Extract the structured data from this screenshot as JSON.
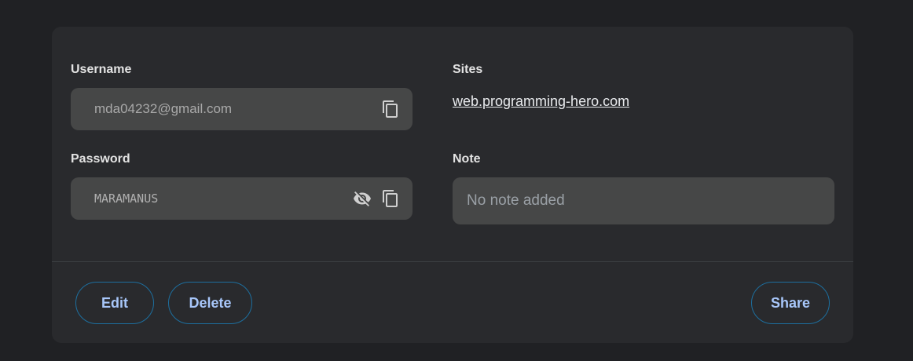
{
  "fields": {
    "username_label": "Username",
    "username_value": "mda04232@gmail.com",
    "password_label": "Password",
    "password_value": "MARAMANUS",
    "sites_label": "Sites",
    "site_url": "web.programming-hero.com",
    "note_label": "Note",
    "note_placeholder": "No note added"
  },
  "icons": {
    "copy": "copy-icon",
    "hide_password": "visibility-off-icon"
  },
  "actions": {
    "edit": "Edit",
    "delete": "Delete",
    "share": "Share"
  },
  "colors": {
    "background": "#202124",
    "card": "#292a2d",
    "field": "#464747",
    "button_border": "#1d6f9f",
    "button_text": "#a8c7fa"
  }
}
